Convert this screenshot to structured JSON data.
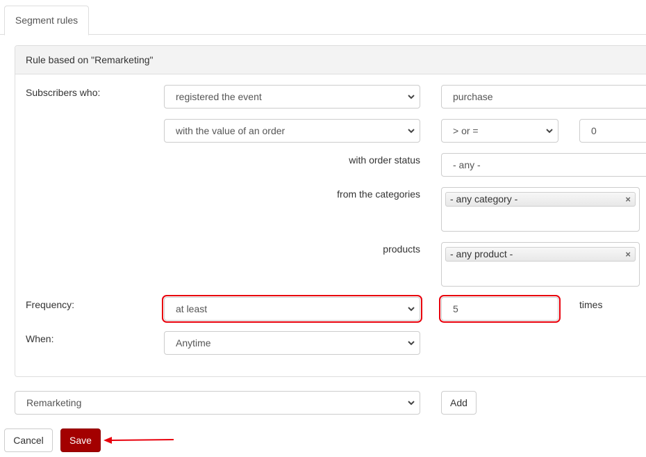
{
  "tabs": [
    {
      "label": "Segment rules",
      "active": true
    }
  ],
  "panel": {
    "heading": "Rule based on \"Remarketing\"",
    "subscribers_label": "Subscribers who:",
    "action_select": "registered the event",
    "event_input": "purchase",
    "condition_select": "with the value of an order",
    "operator_select": "> or =",
    "value_input": "0",
    "order_status_label": "with order status",
    "order_status_select": "- any -",
    "categories_label": "from the categories",
    "categories_chip": "- any category -",
    "products_label": "products",
    "products_chip": "- any product -",
    "frequency_label": "Frequency:",
    "frequency_select": "at least",
    "frequency_input": "5",
    "times_label": "times",
    "when_label": "When:",
    "when_select": "Anytime"
  },
  "footer": {
    "rule_type_select": "Remarketing",
    "add_label": "Add",
    "cancel_label": "Cancel",
    "save_label": "Save"
  },
  "icons": {
    "remove": "×"
  },
  "colors": {
    "primary": "#a30000",
    "highlight": "#e8000c",
    "annotation_arrow": "#e8000c"
  }
}
